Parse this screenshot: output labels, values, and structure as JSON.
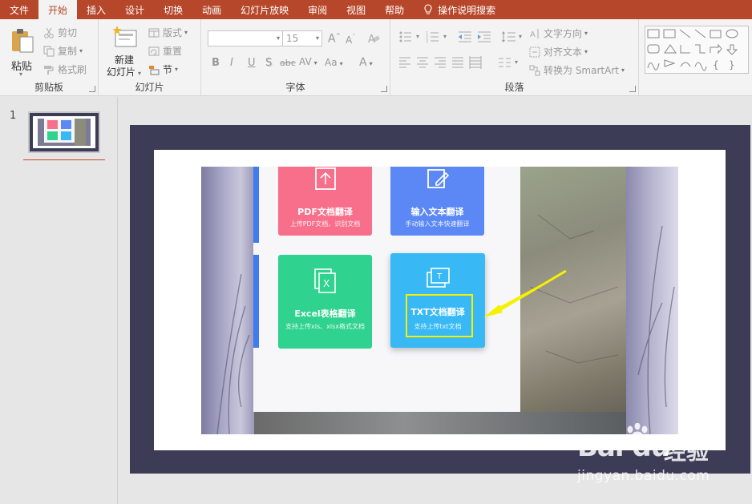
{
  "ribbon_tabs": [
    {
      "label": "文件",
      "active": false
    },
    {
      "label": "开始",
      "active": true
    },
    {
      "label": "插入",
      "active": false
    },
    {
      "label": "设计",
      "active": false
    },
    {
      "label": "切换",
      "active": false
    },
    {
      "label": "动画",
      "active": false
    },
    {
      "label": "幻灯片放映",
      "active": false
    },
    {
      "label": "审阅",
      "active": false
    },
    {
      "label": "视图",
      "active": false
    },
    {
      "label": "帮助",
      "active": false
    }
  ],
  "tell_me": "操作说明搜索",
  "clipboard": {
    "paste": "粘贴",
    "cut": "剪切",
    "copy": "复制",
    "format_painter": "格式刷",
    "group_label": "剪贴板"
  },
  "slides_group": {
    "new_slide_line1": "新建",
    "new_slide_line2": "幻灯片",
    "layout": "版式",
    "reset": "重置",
    "section": "节",
    "group_label": "幻灯片"
  },
  "font_group": {
    "font_name": "",
    "font_size": "15",
    "bold": "B",
    "italic": "I",
    "underline": "U",
    "shadow": "S",
    "strike": "abc",
    "spacing": "AV",
    "case": "Aa",
    "color": "A",
    "grow": "A",
    "shrink": "A",
    "group_label": "字体"
  },
  "paragraph_group": {
    "text_direction": "文字方向",
    "align_text": "对齐文本",
    "smartart": "转换为 SmartArt",
    "group_label": "段落"
  },
  "thumbnails": [
    {
      "number": "1"
    }
  ],
  "slide": {
    "cards": {
      "pdf": {
        "title": "PDF文档翻译",
        "subtitle": "上传PDF文档，识别文档"
      },
      "input": {
        "title": "输入文本翻译",
        "subtitle": "手动输入文本快速翻译"
      },
      "excel": {
        "title": "Excel表格翻译",
        "subtitle": "支持上传xls、xlsx格式文档"
      },
      "txt": {
        "title": "TXT文档翻译",
        "subtitle": "支持上传txt文档"
      }
    },
    "icon_letters": {
      "excel": "X",
      "txt": "T"
    }
  },
  "watermark": {
    "logo": "Bai du",
    "jingyan": "经验",
    "url": "jingyan.baidu.com"
  },
  "colors": {
    "ribbon_red": "#b7472a",
    "slide_border": "#3c3c56",
    "card_pdf": "#f76f8a",
    "card_input": "#5b88f5",
    "card_excel": "#2fd28e",
    "card_txt": "#38b9f5",
    "highlight": "#f5f100"
  }
}
